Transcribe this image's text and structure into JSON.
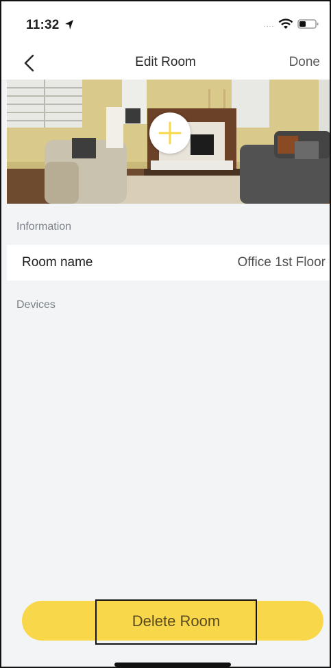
{
  "status_bar": {
    "time": "11:32",
    "signal_dots": "....",
    "icons": [
      "location-arrow-icon",
      "wifi-icon",
      "battery-icon"
    ]
  },
  "nav": {
    "back_icon": "chevron-left-icon",
    "title": "Edit Room",
    "done_label": "Done"
  },
  "photo": {
    "add_icon": "plus-icon",
    "accent_color": "#f8d84a"
  },
  "information": {
    "header": "Information",
    "room_name_label": "Room name",
    "room_name_value": "Office 1st Floor"
  },
  "devices": {
    "header": "Devices"
  },
  "actions": {
    "delete_label": "Delete Room"
  }
}
